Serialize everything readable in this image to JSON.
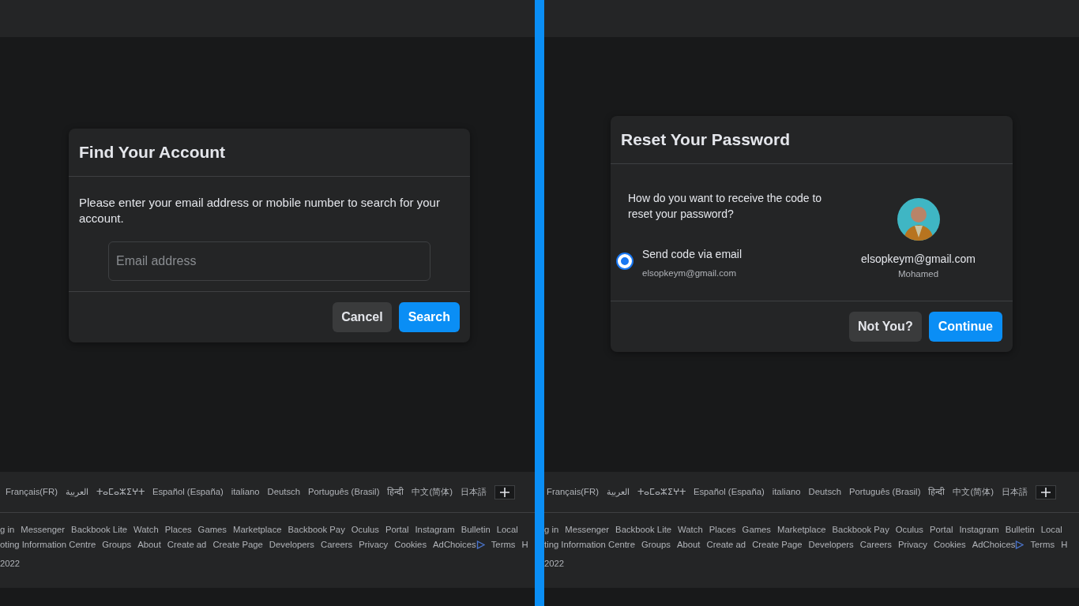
{
  "panels": [
    {
      "dialog": {
        "kind": "find_account",
        "title": "Find Your Account",
        "message": "Please enter your email address or mobile number to search for your account.",
        "field": {
          "placeholder": "Email address"
        },
        "buttons": [
          {
            "label": "Cancel",
            "kind": "secondary"
          },
          {
            "label": "Search",
            "kind": "primary"
          }
        ]
      },
      "footer": {
        "languages": [
          "Français(FR)",
          "العربية",
          "ⵜⴰⵎⴰⵣⵉⵖⵜ",
          "Español (España)",
          "italiano",
          "Deutsch",
          "Português (Brasil)",
          "हिन्दी",
          "中文(简体)",
          "日本語"
        ],
        "links_row_1": [
          "g in",
          "Messenger",
          "Backbook Lite",
          "Watch",
          "Places",
          "Games",
          "Marketplace",
          "Backbook Pay",
          "Oculus",
          "Portal",
          "Instagram",
          "Bulletin",
          "Local"
        ],
        "links_row_2": [
          "oting Information Centre",
          "Groups",
          "About",
          "Create ad",
          "Create Page",
          "Developers",
          "Careers",
          "Privacy",
          "Cookies",
          "AdChoices",
          "Terms",
          "H"
        ],
        "copyright": "2022"
      }
    },
    {
      "dialog": {
        "kind": "reset_password",
        "title": "Reset Your Password",
        "message": "How do you want to receive the code to reset your password?",
        "options": [
          {
            "label": "Send code via email",
            "detail": "elsopkeym@gmail.com",
            "selected": true
          }
        ],
        "account": {
          "email": "elsopkeym@gmail.com",
          "name": "Mohamed"
        },
        "buttons": [
          {
            "label": "Not You?",
            "kind": "secondary"
          },
          {
            "label": "Continue",
            "kind": "primary"
          }
        ]
      },
      "footer": {
        "languages": [
          "Français(FR)",
          "العربية",
          "ⵜⴰⵎⴰⵣⵉⵖⵜ",
          "Español (España)",
          "italiano",
          "Deutsch",
          "Português (Brasil)",
          "हिन्दी",
          "中文(简体)",
          "日本語"
        ],
        "links_row_1": [
          "g in",
          "Messenger",
          "Backbook Lite",
          "Watch",
          "Places",
          "Games",
          "Marketplace",
          "Backbook Pay",
          "Oculus",
          "Portal",
          "Instagram",
          "Bulletin",
          "Local"
        ],
        "links_row_2": [
          "ting Information Centre",
          "Groups",
          "About",
          "Create ad",
          "Create Page",
          "Developers",
          "Careers",
          "Privacy",
          "Cookies",
          "AdChoices",
          "Terms",
          "H"
        ],
        "copyright": "2022"
      }
    }
  ]
}
